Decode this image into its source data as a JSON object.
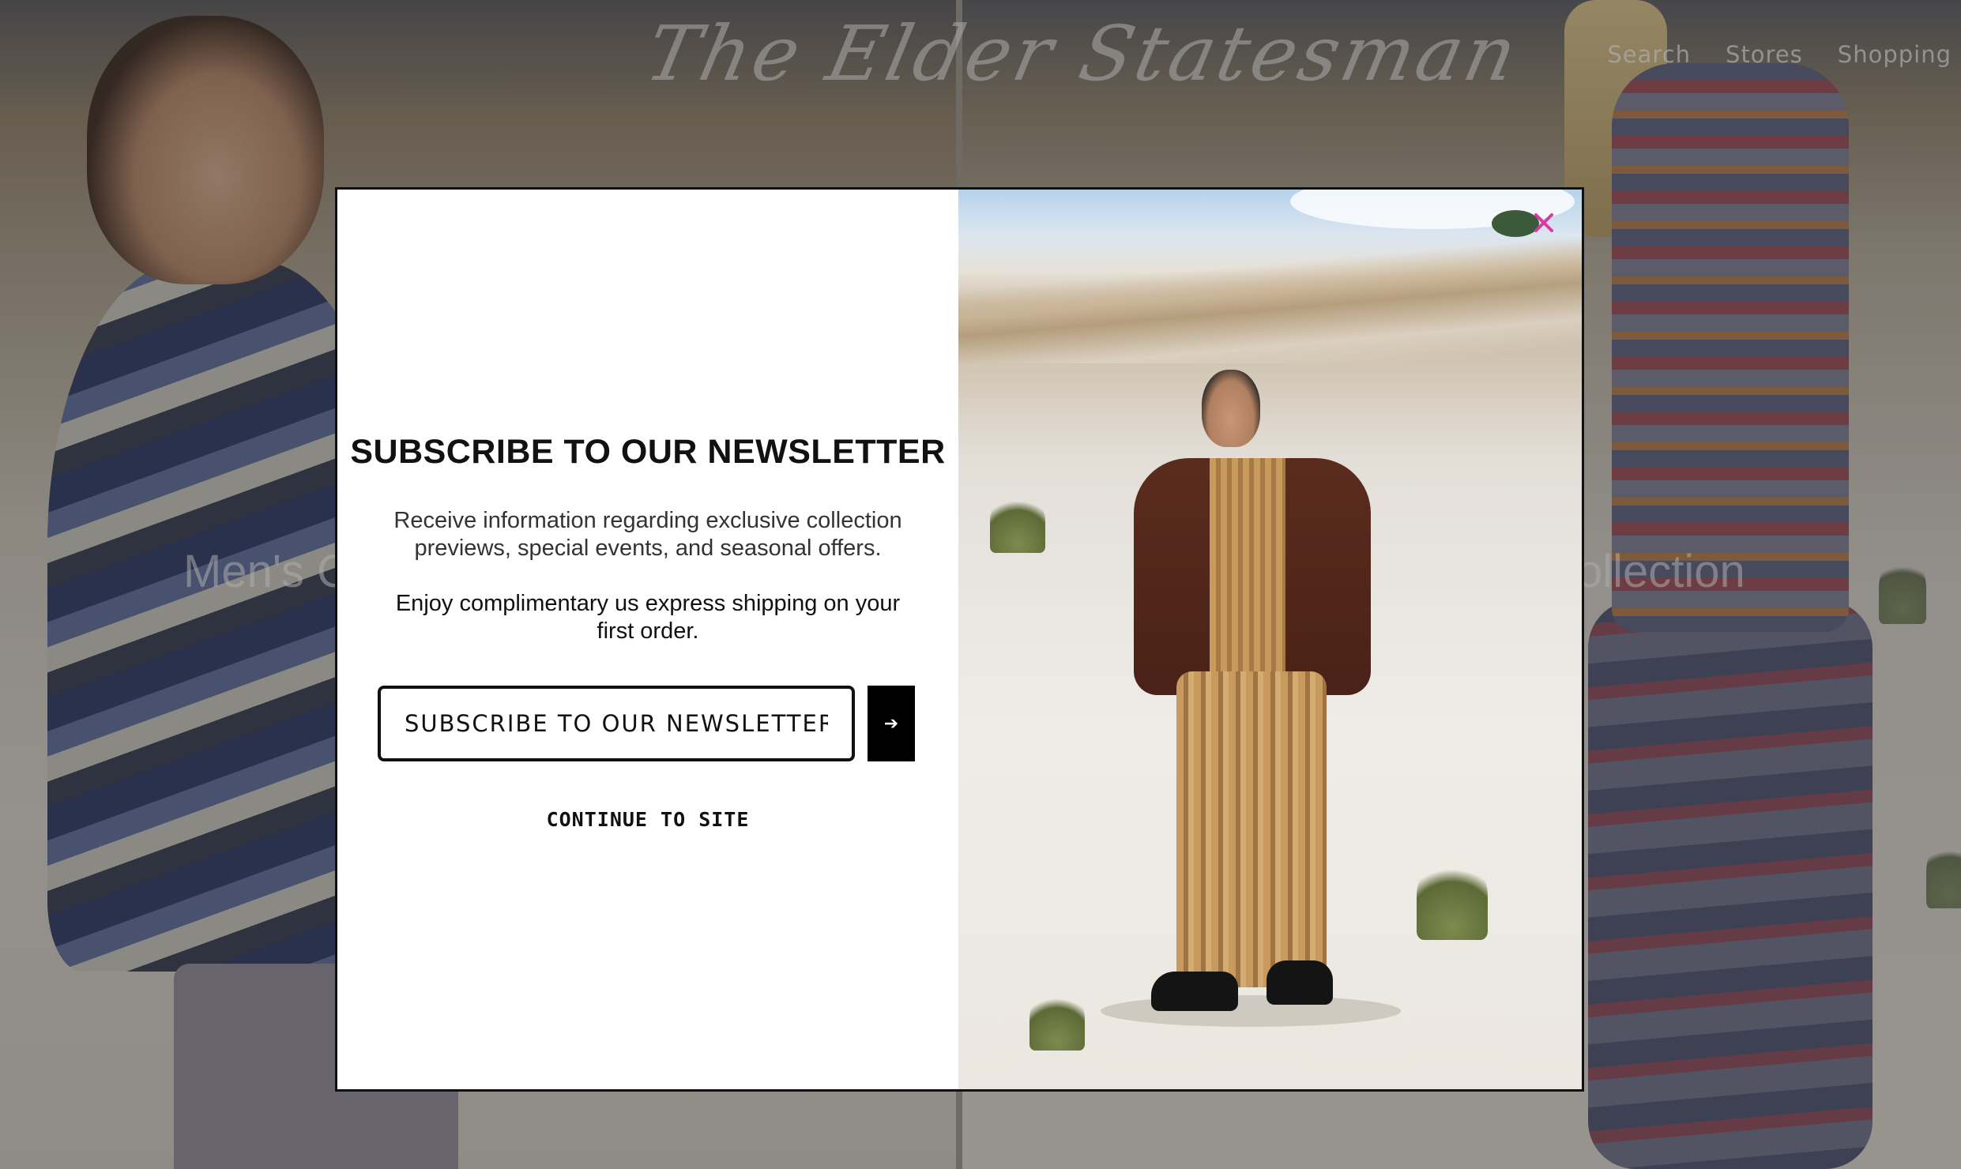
{
  "brand": {
    "logo_text": "The Elder Statesman"
  },
  "nav": {
    "items": [
      "Search",
      "Stores",
      "Shopping"
    ]
  },
  "background": {
    "left_category": "Men's Collection",
    "right_category": "Women's Collection",
    "left_visible": "Men's C",
    "right_visible": "ollection"
  },
  "modal": {
    "headline": "SUBSCRIBE TO OUR NEWSLETTER",
    "body_1": "Receive information regarding exclusive collection previews, special events, and seasonal offers.",
    "body_2": "Enjoy complimentary us express shipping on your first order.",
    "input_placeholder": "SUBSCRIBE TO OUR NEWSLETTER",
    "submit_icon": "arrow-right-icon",
    "submit_glyph": "➔",
    "continue_label": "CONTINUE TO SITE",
    "close_icon": "close-icon"
  },
  "colors": {
    "modal_bg": "#ffffff",
    "button_bg": "#000000",
    "close_color": "#d93aa0",
    "border": "#111111"
  }
}
